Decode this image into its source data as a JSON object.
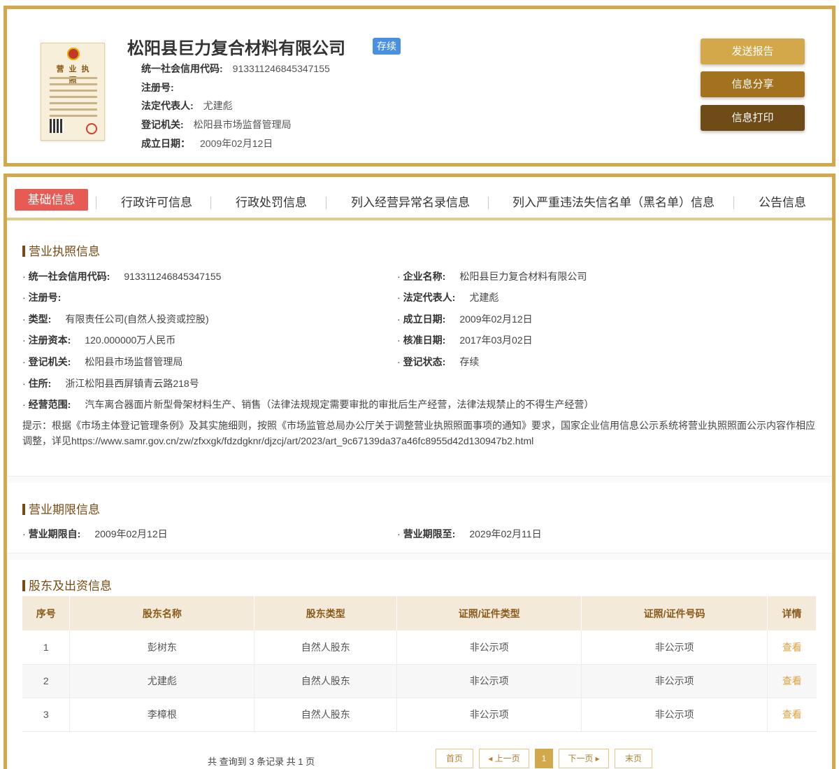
{
  "company": {
    "name": "松阳县巨力复合材料有限公司",
    "status": "存续",
    "license_thumb_title": "营 业 执 照",
    "credit_code_label": "统一社会信用代码:",
    "credit_code": "913311246845347155",
    "reg_no_label": "注册号:",
    "reg_no": "",
    "legal_rep_label": "法定代表人:",
    "legal_rep": "尤建彪",
    "authority_label": "登记机关:",
    "authority": "松阳县市场监督管理局",
    "founded_label": "成立日期：",
    "founded": "2009年02月12日"
  },
  "actions": {
    "send_report": "发送报告",
    "share": "信息分享",
    "print": "信息打印"
  },
  "tabs": [
    {
      "label": "基础信息"
    },
    {
      "label": "行政许可信息"
    },
    {
      "label": "行政处罚信息"
    },
    {
      "label": "列入经营异常名录信息"
    },
    {
      "label": "列入严重违法失信名单（黑名单）信息"
    },
    {
      "label": "公告信息"
    }
  ],
  "license_section": {
    "title": "营业执照信息",
    "bullet": "·",
    "credit_code_label": "统一社会信用代码:",
    "credit_code": "913311246845347155",
    "company_name_label": "企业名称:",
    "company_name": "松阳县巨力复合材料有限公司",
    "reg_no_label": "注册号:",
    "reg_no": "",
    "legal_rep_label": "法定代表人:",
    "legal_rep": "尤建彪",
    "type_label": "类型:",
    "type": "有限责任公司(自然人投资或控股)",
    "founded_label": "成立日期:",
    "founded": "2009年02月12日",
    "capital_label": "注册资本:",
    "capital": "120.000000万人民币",
    "approval_label": "核准日期:",
    "approval": "2017年03月02日",
    "authority_label": "登记机关:",
    "authority": "松阳县市场监督管理局",
    "reg_status_label": "登记状态:",
    "reg_status": "存续",
    "address_label": "住所:",
    "address": "浙江松阳县西屏镇青云路218号",
    "scope_label": "经营范围:",
    "scope": "汽车离合器面片新型骨架材料生产、销售（法律法规规定需要审批的审批后生产经营，法律法规禁止的不得生产经营）",
    "tip": "提示：根据《市场主体登记管理条例》及其实施细则，按照《市场监管总局办公厅关于调整营业执照照面事项的通知》要求，国家企业信用信息公示系统将营业执照照面公示内容作相应调整，详见https://www.samr.gov.cn/zw/zfxxgk/fdzdgknr/djzcj/art/2023/art_9c67139da37a46fc8955d42d130947b2.html"
  },
  "term_section": {
    "title": "营业期限信息",
    "from_label": "营业期限自:",
    "from": "2009年02月12日",
    "to_label": "营业期限至:",
    "to": "2029年02月11日"
  },
  "shareholder_section": {
    "title": "股东及出资信息",
    "columns": [
      "序号",
      "股东名称",
      "股东类型",
      "证照/证件类型",
      "证照/证件号码",
      "详情"
    ],
    "rows": [
      {
        "no": "1",
        "name": "彭树东",
        "type": "自然人股东",
        "id_type": "非公示项",
        "id_no": "非公示项",
        "detail": "查看"
      },
      {
        "no": "2",
        "name": "尤建彪",
        "type": "自然人股东",
        "id_type": "非公示项",
        "id_no": "非公示项",
        "detail": "查看"
      },
      {
        "no": "3",
        "name": "李樟根",
        "type": "自然人股东",
        "id_type": "非公示项",
        "id_no": "非公示项",
        "detail": "查看"
      }
    ],
    "summary": "共 查询到 3 条记录 共 1 页"
  },
  "pagination": {
    "first": "首页",
    "prev": "◂ 上一页",
    "current": "1",
    "next": "下一页 ▸",
    "last": "末页"
  },
  "colors": {
    "gold": "#d3a84a",
    "brown": "#a3721f",
    "dark_brown": "#6e4b17",
    "active_tab": "#e65c54",
    "status_tag": "#4a90e2",
    "section_title": "#7a4a12"
  }
}
